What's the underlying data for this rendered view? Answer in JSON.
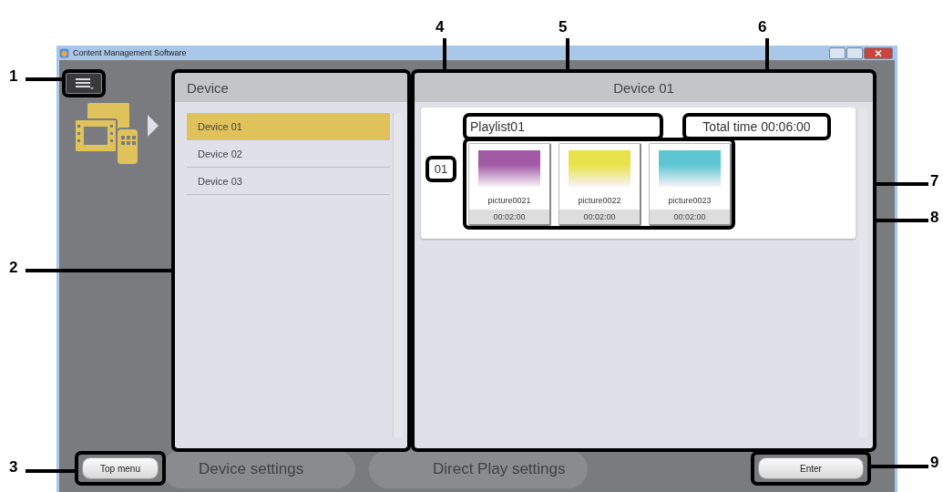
{
  "window": {
    "title": "Content Management Software"
  },
  "device_panel": {
    "title": "Device",
    "items": [
      {
        "label": "Device 01",
        "selected": true
      },
      {
        "label": "Device 02",
        "selected": false
      },
      {
        "label": "Device 03",
        "selected": false
      }
    ]
  },
  "playlist_panel": {
    "title": "Device 01",
    "number": "01",
    "name": "Playlist01",
    "total_time": "Total time 00:06:00",
    "items": [
      {
        "name": "picture0021",
        "duration": "00:02:00",
        "color": "#a35aa6"
      },
      {
        "name": "picture0022",
        "duration": "00:02:00",
        "color": "#e8e24a"
      },
      {
        "name": "picture0023",
        "duration": "00:02:00",
        "color": "#5ec6d2"
      }
    ]
  },
  "background_buttons": [
    "Device settings",
    "Direct Play settings"
  ],
  "buttons": {
    "top_menu": "Top menu",
    "enter": "Enter"
  },
  "callouts": [
    "1",
    "2",
    "3",
    "4",
    "5",
    "6",
    "7",
    "8",
    "9"
  ]
}
